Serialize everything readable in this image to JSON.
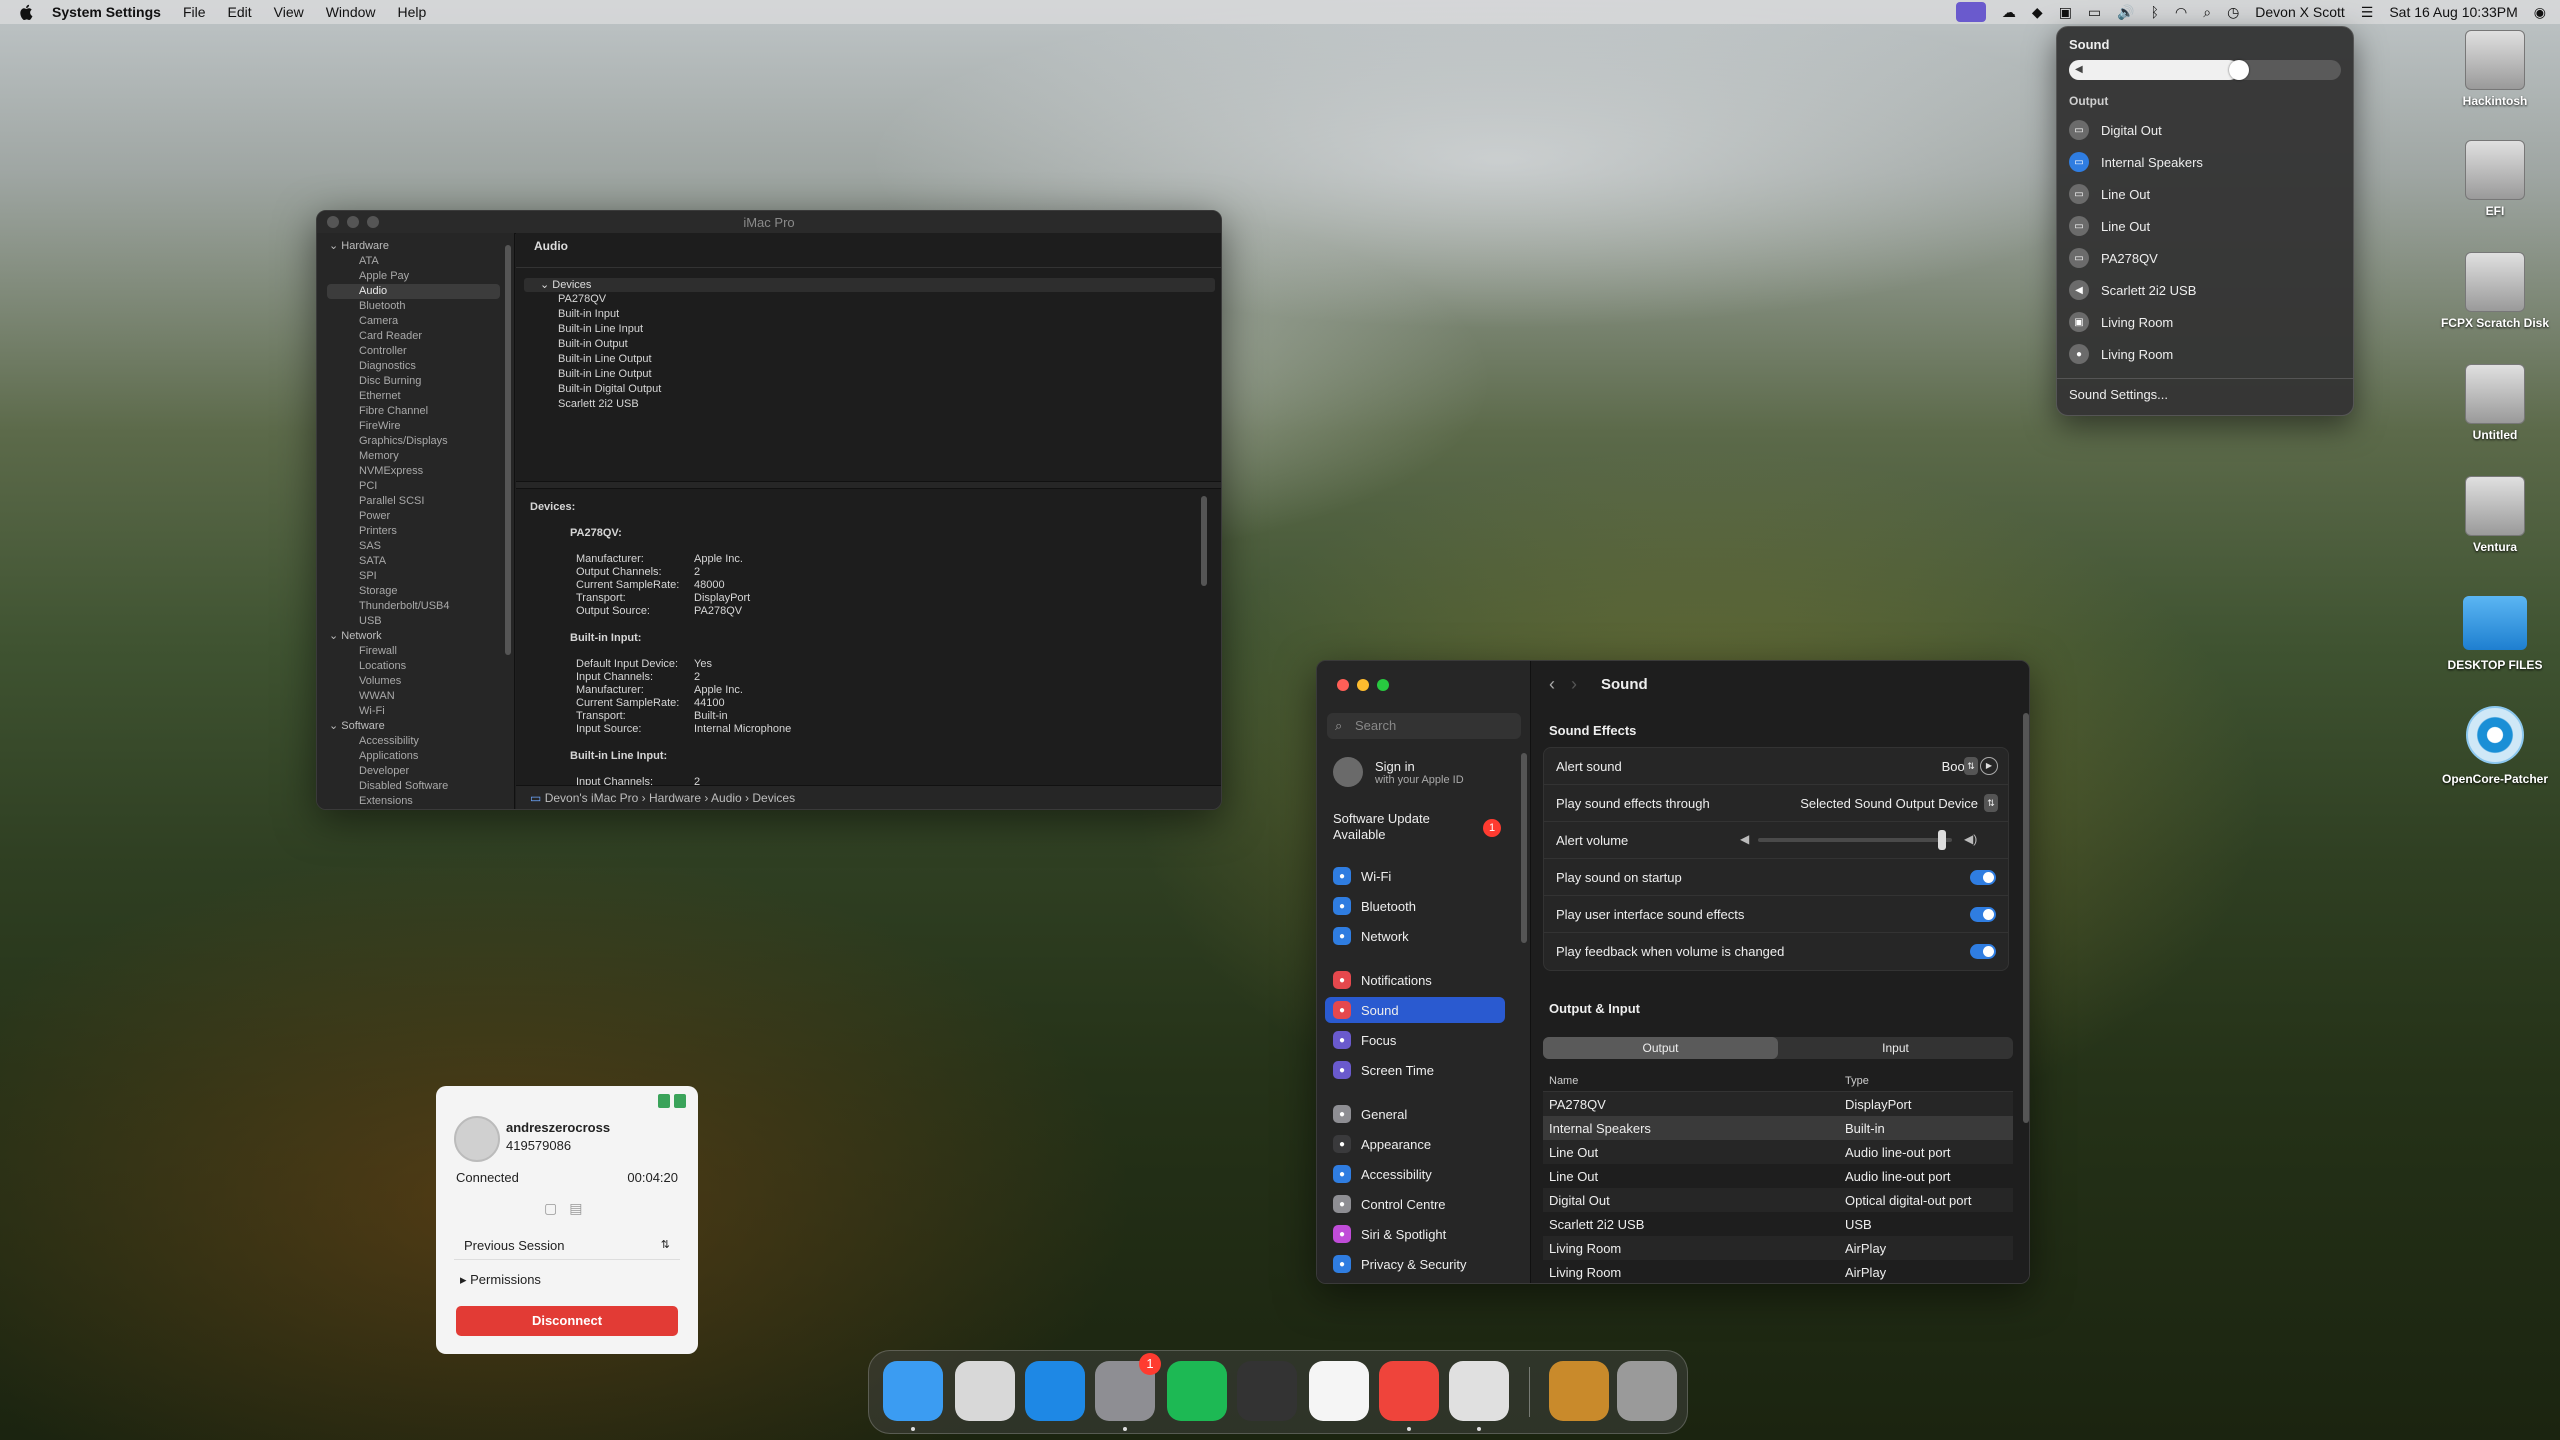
{
  "menubar": {
    "app_name": "System Settings",
    "menus": [
      "File",
      "Edit",
      "View",
      "Window",
      "Help"
    ],
    "user": "Devon X Scott",
    "datetime": "Sat 16 Aug  10:33PM"
  },
  "sysinfo": {
    "title": "iMac Pro",
    "sidebar": [
      {
        "label": "Hardware",
        "group": true
      },
      {
        "label": "ATA"
      },
      {
        "label": "Apple Pay"
      },
      {
        "label": "Audio",
        "selected": true
      },
      {
        "label": "Bluetooth"
      },
      {
        "label": "Camera"
      },
      {
        "label": "Card Reader"
      },
      {
        "label": "Controller"
      },
      {
        "label": "Diagnostics"
      },
      {
        "label": "Disc Burning"
      },
      {
        "label": "Ethernet"
      },
      {
        "label": "Fibre Channel"
      },
      {
        "label": "FireWire"
      },
      {
        "label": "Graphics/Displays"
      },
      {
        "label": "Memory"
      },
      {
        "label": "NVMExpress"
      },
      {
        "label": "PCI"
      },
      {
        "label": "Parallel SCSI"
      },
      {
        "label": "Power"
      },
      {
        "label": "Printers"
      },
      {
        "label": "SAS"
      },
      {
        "label": "SATA"
      },
      {
        "label": "SPI"
      },
      {
        "label": "Storage"
      },
      {
        "label": "Thunderbolt/USB4"
      },
      {
        "label": "USB"
      },
      {
        "label": "Network",
        "group": true
      },
      {
        "label": "Firewall"
      },
      {
        "label": "Locations"
      },
      {
        "label": "Volumes"
      },
      {
        "label": "WWAN"
      },
      {
        "label": "Wi-Fi"
      },
      {
        "label": "Software",
        "group": true
      },
      {
        "label": "Accessibility"
      },
      {
        "label": "Applications"
      },
      {
        "label": "Developer"
      },
      {
        "label": "Disabled Software"
      },
      {
        "label": "Extensions"
      }
    ],
    "section_header": "Audio",
    "devices_label": "Devices",
    "devices": [
      "PA278QV",
      "Built-in Input",
      "Built-in Line Input",
      "Built-in Output",
      "Built-in Line Output",
      "Built-in Line Output",
      "Built-in Digital Output",
      "Scarlett 2i2 USB"
    ],
    "detail_heading": "Devices:",
    "detail": [
      {
        "name": "PA278QV:",
        "props": [
          [
            "Manufacturer:",
            "Apple Inc."
          ],
          [
            "Output Channels:",
            "2"
          ],
          [
            "Current SampleRate:",
            "48000"
          ],
          [
            "Transport:",
            "DisplayPort"
          ],
          [
            "Output Source:",
            "PA278QV"
          ]
        ]
      },
      {
        "name": "Built-in Input:",
        "props": [
          [
            "Default Input Device:",
            "Yes"
          ],
          [
            "Input Channels:",
            "2"
          ],
          [
            "Manufacturer:",
            "Apple Inc."
          ],
          [
            "Current SampleRate:",
            "44100"
          ],
          [
            "Transport:",
            "Built-in"
          ],
          [
            "Input Source:",
            "Internal Microphone"
          ]
        ]
      },
      {
        "name": "Built-in Line Input:",
        "props": [
          [
            "Input Channels:",
            "2"
          ]
        ]
      }
    ],
    "pathbar": "Devon's iMac Pro  ›  Hardware  ›  Audio  ›  Devices"
  },
  "sound_menu": {
    "title": "Sound",
    "volume": 0.62,
    "output_label": "Output",
    "outputs": [
      {
        "label": "Digital Out",
        "icon": "display-icon"
      },
      {
        "label": "Internal Speakers",
        "icon": "display-icon",
        "selected": true
      },
      {
        "label": "Line Out",
        "icon": "display-icon"
      },
      {
        "label": "Line Out",
        "icon": "display-icon"
      },
      {
        "label": "PA278QV",
        "icon": "display-icon"
      },
      {
        "label": "Scarlett 2i2 USB",
        "icon": "speaker-icon"
      },
      {
        "label": "Living Room",
        "icon": "tv-icon"
      },
      {
        "label": "Living Room",
        "icon": "homepod-icon"
      }
    ],
    "settings_link": "Sound Settings..."
  },
  "desktop_icons": [
    {
      "label": "Hackintosh",
      "kind": "disk"
    },
    {
      "label": "EFI",
      "kind": "disk"
    },
    {
      "label": "FCPX Scratch Disk",
      "kind": "disk"
    },
    {
      "label": "Untitled",
      "kind": "disk"
    },
    {
      "label": "Ventura",
      "kind": "disk"
    },
    {
      "label": "DESKTOP FILES",
      "kind": "folder"
    },
    {
      "label": "OpenCore-Patcher",
      "kind": "app"
    }
  ],
  "settings": {
    "search_placeholder": "Search",
    "signin_title": "Sign in",
    "signin_sub": "with your Apple ID",
    "update_text": "Software Update Available",
    "update_badge": "1",
    "nav": [
      {
        "label": "Wi-Fi",
        "color": "#2f7de1"
      },
      {
        "label": "Bluetooth",
        "color": "#2f7de1"
      },
      {
        "label": "Network",
        "color": "#2f7de1"
      },
      {
        "label": "Notifications",
        "color": "#e5484d"
      },
      {
        "label": "Sound",
        "color": "#e5484d",
        "selected": true
      },
      {
        "label": "Focus",
        "color": "#6a5acd"
      },
      {
        "label": "Screen Time",
        "color": "#6a5acd"
      },
      {
        "label": "General",
        "color": "#8e8e93"
      },
      {
        "label": "Appearance",
        "color": "#3a3a3c"
      },
      {
        "label": "Accessibility",
        "color": "#2f7de1"
      },
      {
        "label": "Control Centre",
        "color": "#8e8e93"
      },
      {
        "label": "Siri & Spotlight",
        "color": "#c04cd8"
      },
      {
        "label": "Privacy & Security",
        "color": "#2f7de1"
      }
    ],
    "page_title": "Sound",
    "effects_title": "Sound Effects",
    "alert_sound_label": "Alert sound",
    "alert_sound_value": "Boop",
    "play_through_label": "Play sound effects through",
    "play_through_value": "Selected Sound Output Device",
    "alert_volume_label": "Alert volume",
    "alert_volume": 0.95,
    "toggles": [
      {
        "label": "Play sound on startup",
        "on": true
      },
      {
        "label": "Play user interface sound effects",
        "on": true
      },
      {
        "label": "Play feedback when volume is changed",
        "on": true
      }
    ],
    "io_title": "Output & Input",
    "tab_output": "Output",
    "tab_input": "Input",
    "col_name": "Name",
    "col_type": "Type",
    "devices": [
      {
        "name": "PA278QV",
        "type": "DisplayPort"
      },
      {
        "name": "Internal Speakers",
        "type": "Built-in",
        "selected": true
      },
      {
        "name": "Line Out",
        "type": "Audio line-out port"
      },
      {
        "name": "Line Out",
        "type": "Audio line-out port"
      },
      {
        "name": "Digital Out",
        "type": "Optical digital-out port"
      },
      {
        "name": "Scarlett 2i2 USB",
        "type": "USB"
      },
      {
        "name": "Living Room",
        "type": "AirPlay"
      },
      {
        "name": "Living Room",
        "type": "AirPlay"
      }
    ]
  },
  "remote": {
    "user": "andreszerocross",
    "id": "419579086",
    "status": "Connected",
    "timer": "00:04:20",
    "session_select": "Previous Session",
    "permissions": "Permissions",
    "disconnect": "Disconnect"
  },
  "dock": {
    "apps": [
      {
        "name": "finder",
        "color": "#3b9cf2"
      },
      {
        "name": "launchpad",
        "color": "#d8d8d8"
      },
      {
        "name": "safari",
        "color": "#1e88e5"
      },
      {
        "name": "system-settings",
        "color": "#8e8e93",
        "badge": "1"
      },
      {
        "name": "spotify",
        "color": "#1db954"
      },
      {
        "name": "final-cut-pro",
        "color": "#333333"
      },
      {
        "name": "freeform",
        "color": "#f5f5f5"
      },
      {
        "name": "anydesk",
        "color": "#ef443b"
      },
      {
        "name": "opencore-legacy-patcher",
        "color": "#e0e0e0"
      },
      {
        "name": "package-installer",
        "color": "#c98a2b"
      },
      {
        "name": "trash",
        "color": "#9a9a9a"
      }
    ]
  }
}
